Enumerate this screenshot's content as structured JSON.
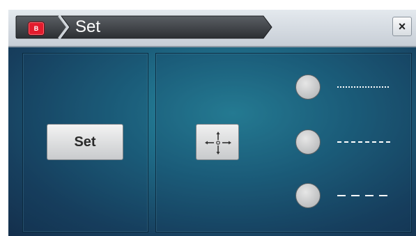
{
  "window": {
    "app_badge": "B",
    "title": "Set",
    "close_label": "×"
  },
  "left_panel": {
    "set_button_label": "Set"
  },
  "right_panel": {
    "move_button_icon": "crosshair-move-icon",
    "line_options": [
      {
        "style": "dotted",
        "icon": "dotted-line-icon"
      },
      {
        "style": "dashed",
        "icon": "dashed-line-icon"
      },
      {
        "style": "long-dashed",
        "icon": "long-dashed-line-icon"
      }
    ]
  },
  "colors": {
    "accent_red": "#e31b2d",
    "panel_teal": "#1e6985",
    "titlebar_dark": "#3a3d41"
  }
}
